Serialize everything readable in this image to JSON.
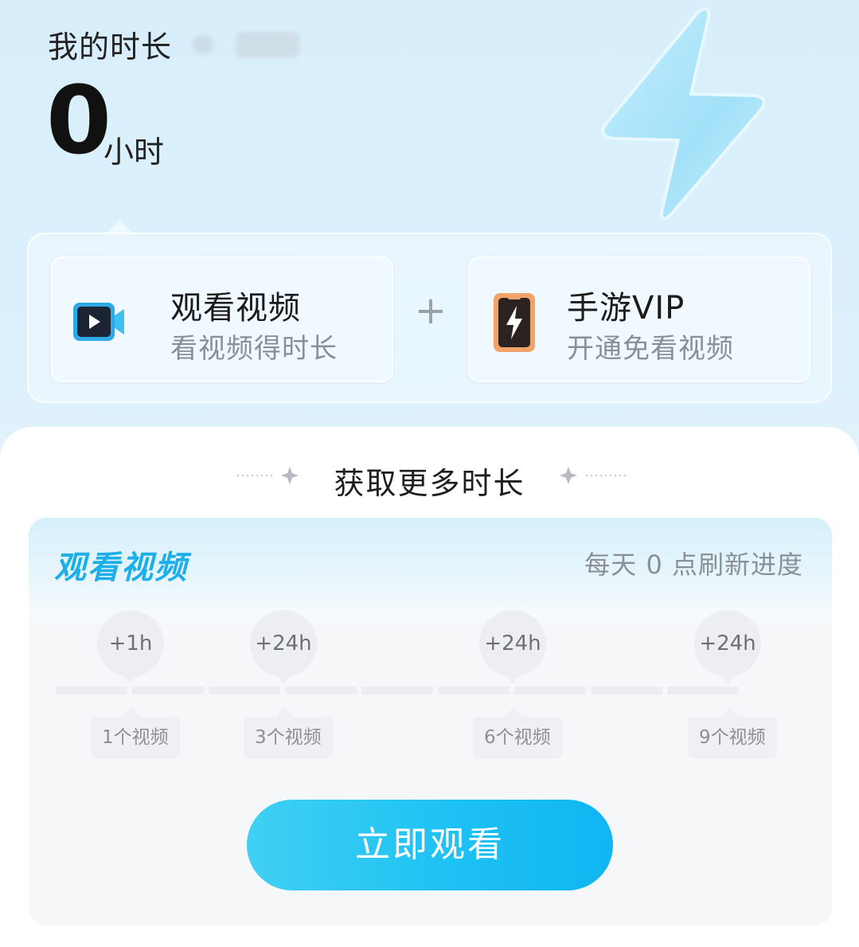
{
  "header": {
    "label": "我的时长",
    "hours_value": "0",
    "hours_unit": "小时"
  },
  "cards": {
    "watch": {
      "title": "观看视频",
      "subtitle": "看视频得时长",
      "icon": "video-play-icon"
    },
    "plus": "+",
    "vip": {
      "title": "手游VIP",
      "subtitle": "开通免看视频",
      "icon": "lightning-battery-icon"
    }
  },
  "section": {
    "title": "获取更多时长"
  },
  "task": {
    "title": "观看视频",
    "refresh_note": "每天 0 点刷新进度",
    "progress_videos_watched": 0,
    "rewards": [
      "+1h",
      "+24h",
      "+24h",
      "+24h"
    ],
    "milestones": [
      "1个视频",
      "3个视频",
      "6个视频",
      "9个视频"
    ],
    "button_label": "立即观看"
  },
  "colors": {
    "accent": "#1eaee8",
    "button_start": "#41d0f3",
    "button_end": "#10b5f2"
  }
}
